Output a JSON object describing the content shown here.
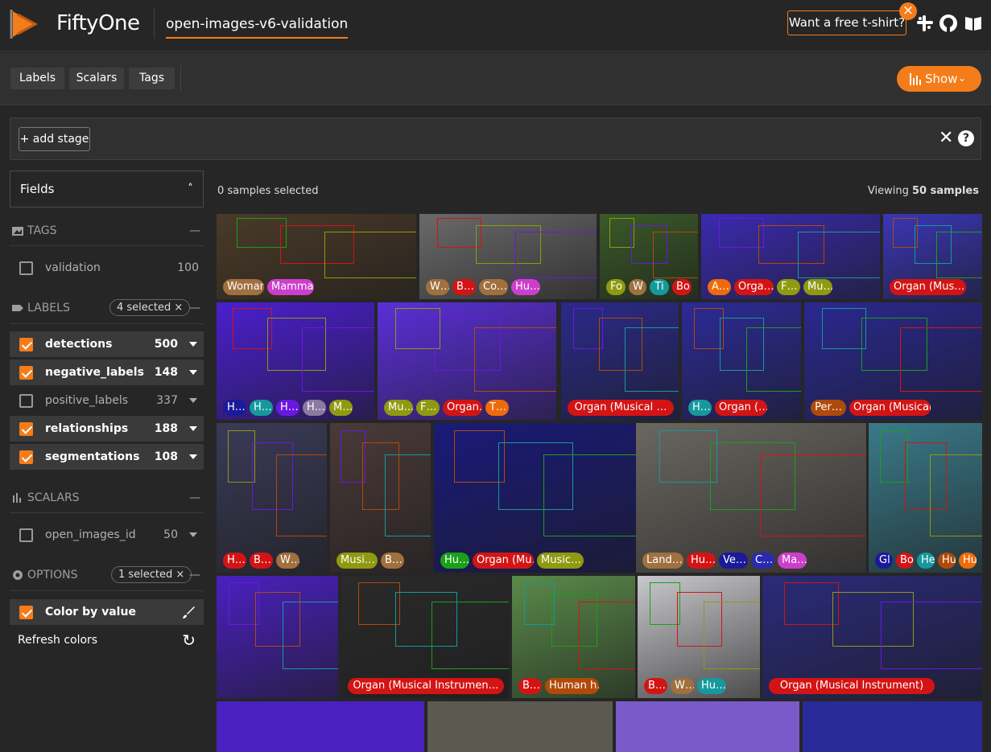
{
  "header": {
    "brand": "FiftyOne",
    "dataset": "open-images-v6-validation",
    "tshirt": "Want a free t-shirt?",
    "icons": [
      "slack-icon",
      "github-icon",
      "docs-icon"
    ]
  },
  "toolbar": {
    "tabs": [
      "Labels",
      "Scalars",
      "Tags"
    ],
    "show": "Show"
  },
  "stages": {
    "add": "+ add stage"
  },
  "sidebar": {
    "fields": "Fields",
    "tags": {
      "title": "TAGS",
      "items": [
        {
          "label": "validation",
          "count": "100",
          "checked": false
        }
      ]
    },
    "labels": {
      "title": "LABELS",
      "selected": "4 selected",
      "items": [
        {
          "label": "detections",
          "count": "500",
          "checked": true
        },
        {
          "label": "negative_labels",
          "count": "148",
          "checked": true
        },
        {
          "label": "positive_labels",
          "count": "337",
          "checked": false
        },
        {
          "label": "relationships",
          "count": "188",
          "checked": true
        },
        {
          "label": "segmentations",
          "count": "108",
          "checked": true
        }
      ]
    },
    "scalars": {
      "title": "SCALARS",
      "items": [
        {
          "label": "open_images_id",
          "count": "50",
          "checked": false
        }
      ]
    },
    "options": {
      "title": "OPTIONS",
      "selected": "1 selected",
      "color_by": "Color by value",
      "refresh": "Refresh colors"
    }
  },
  "grid": {
    "selected": "0 samples selected",
    "viewing_prefix": "Viewing ",
    "viewing_count": "50 samples",
    "rows": [
      [
        {
          "bg": "#4a3a28",
          "labels": [
            [
              "Woman",
              "#a0703e"
            ],
            [
              "Mammal",
              "#cc3fcc"
            ]
          ]
        },
        {
          "bg": "#6a6a6a",
          "labels": [
            [
              "W…",
              "#a0703e"
            ],
            [
              "B…",
              "#d31414"
            ],
            [
              "Co…",
              "#a0703e"
            ],
            [
              "Hu…",
              "#cc3fcc"
            ]
          ]
        },
        {
          "bg": "#3a5a28",
          "labels": [
            [
              "Fo",
              "#8f9a10"
            ],
            [
              "W",
              "#a0703e"
            ],
            [
              "Ti",
              "#16999c"
            ],
            [
              "Bo",
              "#d31414"
            ]
          ]
        },
        {
          "bg": "#3a2ab0",
          "labels": [
            [
              "A…",
              "#ef6b0a"
            ],
            [
              "Orga…",
              "#d31414"
            ],
            [
              "F…",
              "#8f9a10"
            ],
            [
              "Mu…",
              "#8f9a10"
            ]
          ]
        },
        {
          "bg": "#3a36b8",
          "labels": [
            [
              "Organ (Mus…",
              "#d31414"
            ]
          ]
        }
      ],
      [
        {
          "bg": "#4a1fd0",
          "labels": [
            [
              "H…",
              "#1a1a9a"
            ],
            [
              "H…",
              "#16999c"
            ],
            [
              "H…",
              "#6a18e0"
            ],
            [
              "H…",
              "#8a7aa0"
            ],
            [
              "M…",
              "#8f9a10"
            ]
          ]
        },
        {
          "bg": "#5a2fd8",
          "labels": [
            [
              "Mu…",
              "#8f9a10"
            ],
            [
              "F…",
              "#8f9a10"
            ],
            [
              "Organ…",
              "#d31414"
            ],
            [
              "T…",
              "#ef6b0a"
            ]
          ]
        },
        {
          "bg": "#2a2a8a",
          "labels": [
            [
              "Organ (Musical …",
              "#d31414"
            ]
          ]
        },
        {
          "bg": "#2c2a98",
          "labels": [
            [
              "H…",
              "#16999c"
            ],
            [
              "Organ (…",
              "#d31414"
            ]
          ]
        },
        {
          "bg": "#2a2890",
          "labels": [
            [
              "Per…",
              "#b04a0a"
            ],
            [
              "Organ (Musical Ins…",
              "#d31414"
            ]
          ]
        }
      ],
      [
        {
          "bg": "#3a3a58",
          "labels": [
            [
              "H…",
              "#d31414"
            ],
            [
              "B…",
              "#d31414"
            ],
            [
              "W…",
              "#a0703e"
            ]
          ]
        },
        {
          "bg": "#4a3a38",
          "labels": [
            [
              "Musi…",
              "#8f9a10"
            ],
            [
              "B…",
              "#a0703e"
            ]
          ]
        },
        {
          "bg": "#1a1a7a",
          "labels": [
            [
              "Hu…",
              "#1aa01a"
            ],
            [
              "Organ (Mu…",
              "#d31414"
            ],
            [
              "Music…",
              "#8f9a10"
            ]
          ]
        },
        {
          "bg": "#6a6660",
          "labels": [
            [
              "Land…",
              "#a0703e"
            ],
            [
              "Hu…",
              "#d31414"
            ],
            [
              "Ve…",
              "#1a1a9a"
            ],
            [
              "C…",
              "#2a2ab0"
            ],
            [
              "Ma…",
              "#cc3fcc"
            ]
          ]
        },
        {
          "bg": "#3a7a8a",
          "labels": [
            [
              "Gl",
              "#1a1a9a"
            ],
            [
              "Bo",
              "#d31414"
            ],
            [
              "He",
              "#16999c"
            ],
            [
              "Hu",
              "#b04a0a"
            ],
            [
              "Hu",
              "#ef6b0a"
            ]
          ]
        }
      ],
      [
        {
          "bg": "#4a20c0",
          "labels": []
        },
        {
          "bg": "#2a2a2a",
          "labels": [
            [
              "Organ (Musical Instrumen…",
              "#d31414"
            ]
          ]
        },
        {
          "bg": "#5a8a4a",
          "labels": [
            [
              "B…",
              "#d31414"
            ],
            [
              "Human h…",
              "#b04a0a"
            ]
          ]
        },
        {
          "bg": "#c8c8cc",
          "labels": [
            [
              "B…",
              "#d31414"
            ],
            [
              "W…",
              "#a0703e"
            ],
            [
              "Hu…",
              "#16999c"
            ]
          ]
        },
        {
          "bg": "#2a2a7a",
          "labels": [
            [
              "Organ (Musical Instrument)",
              "#d31414"
            ]
          ]
        }
      ]
    ]
  }
}
